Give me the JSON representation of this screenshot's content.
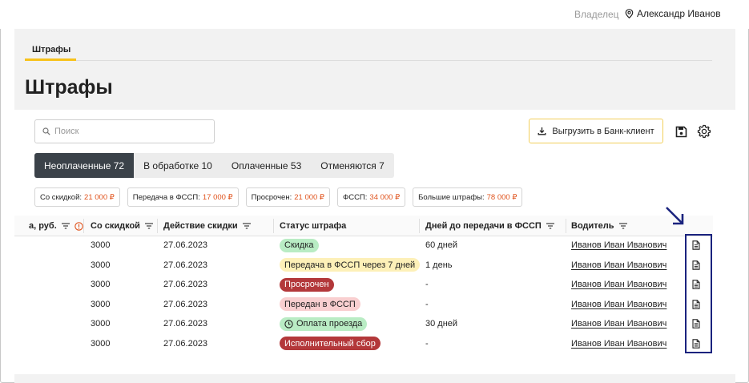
{
  "header": {
    "owner_label": "Владелец",
    "user_name": "Александр Иванов"
  },
  "tabs": [
    {
      "label": "Штрафы",
      "active": true
    }
  ],
  "page_title": "Штрафы",
  "search": {
    "placeholder": "Поиск"
  },
  "toolbar": {
    "export_label": "Выгрузить в Банк-клиент",
    "save_icon": "save-icon",
    "settings_icon": "gear-icon"
  },
  "segments": [
    {
      "label": "Неоплаченные 72",
      "active": true
    },
    {
      "label": "В обработке 10",
      "active": false
    },
    {
      "label": "Оплаченные 53",
      "active": false
    },
    {
      "label": "Отменяются 7",
      "active": false
    }
  ],
  "summary_chips": [
    {
      "label": "Со скидкой:",
      "amount": "21 000 ₽"
    },
    {
      "label": "Передача в ФССП:",
      "amount": "17 000 ₽"
    },
    {
      "label": "Просрочен:",
      "amount": "21 000 ₽"
    },
    {
      "label": "ФССП:",
      "amount": "34 000 ₽"
    },
    {
      "label": "Большие штрафы:",
      "amount": "78 000 ₽"
    }
  ],
  "columns": [
    {
      "label": "а, руб."
    },
    {
      "label": "Со скидкой"
    },
    {
      "label": "Действие скидки"
    },
    {
      "label": "Статус штрафа"
    },
    {
      "label": "Дней до передачи в ФССП"
    },
    {
      "label": "Водитель"
    }
  ],
  "rows": [
    {
      "discount": "3000",
      "discount_until": "27.06.2023",
      "status": "Скидка",
      "status_style": "green",
      "days": "60 дней",
      "driver": "Иванов Иван Иванович"
    },
    {
      "discount": "3000",
      "discount_until": "27.06.2023",
      "status": "Передача в ФССП через 7 дней",
      "status_style": "yellow",
      "days": "1 день",
      "driver": "Иванов Иван Иванович"
    },
    {
      "discount": "3000",
      "discount_until": "27.06.2023",
      "status": "Просрочен",
      "status_style": "red",
      "days": "-",
      "driver": "Иванов Иван Иванович"
    },
    {
      "discount": "3000",
      "discount_until": "27.06.2023",
      "status": "Передан в ФССП",
      "status_style": "pink",
      "days": "-",
      "driver": "Иванов Иван Иванович"
    },
    {
      "discount": "3000",
      "discount_until": "27.06.2023",
      "status": "Оплата проезда",
      "status_style": "green-icon",
      "days": "30 дней",
      "driver": "Иванов Иван Иванович"
    },
    {
      "discount": "3000",
      "discount_until": "27.06.2023",
      "status": "Исполнительный сбор",
      "status_style": "red",
      "days": "-",
      "driver": "Иванов Иван Иванович"
    }
  ],
  "colors": {
    "accent": "#f7c21b",
    "amount": "#e0541e",
    "active_segment": "#3b4249",
    "badge_green": "#b9ecc4",
    "badge_yellow": "#fdf0b8",
    "badge_red": "#b3383a",
    "badge_pink": "#f9cfd0",
    "highlight": "#1a237e"
  }
}
